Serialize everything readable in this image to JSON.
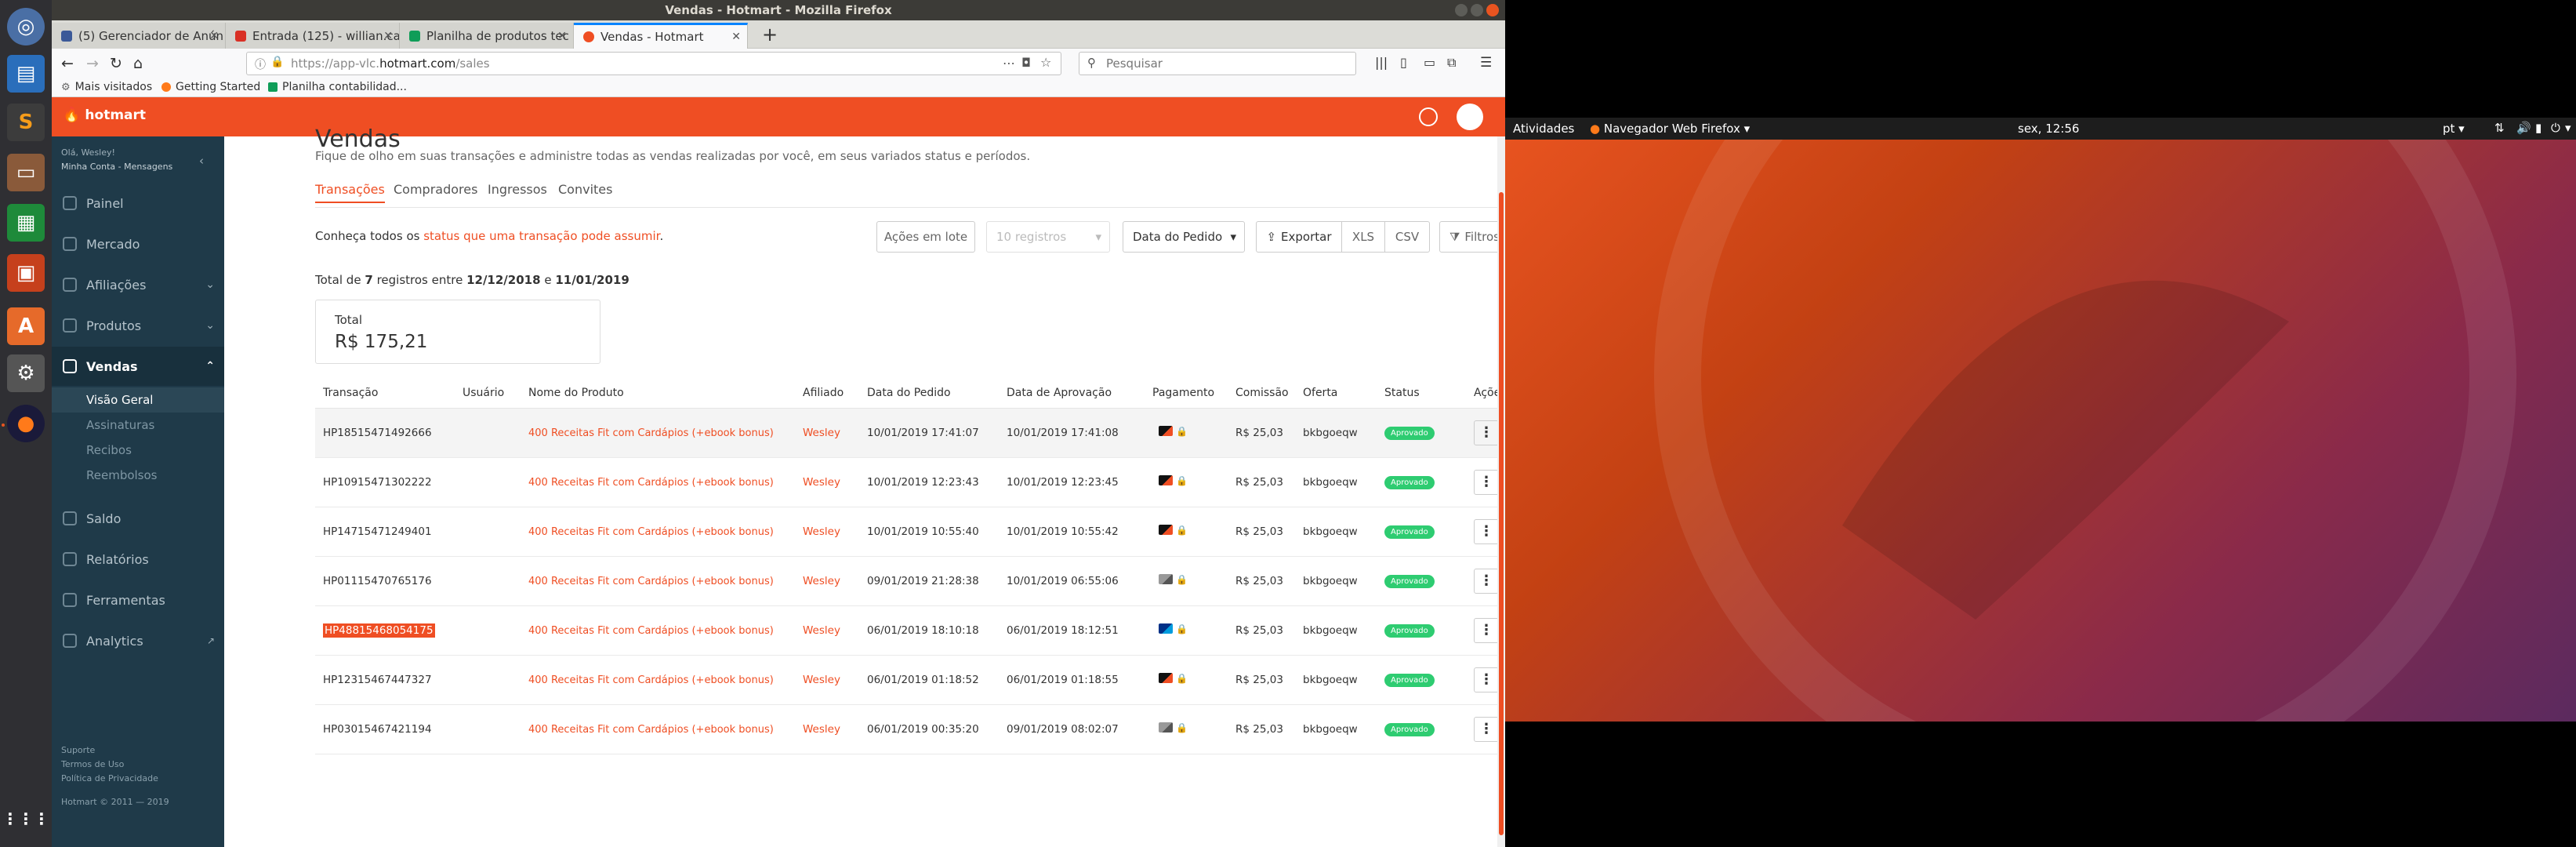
{
  "window": {
    "title": "Vendas - Hotmart - Mozilla Firefox"
  },
  "tabs": [
    {
      "label": "(5) Gerenciador de Anún",
      "color": "#3b5998"
    },
    {
      "label": "Entrada (125) - willian.ca",
      "color": "#d93025"
    },
    {
      "label": "Planilha de produtos tec",
      "color": "#0f9d58"
    },
    {
      "label": "Vendas - Hotmart",
      "color": "#ef4e23"
    }
  ],
  "url": {
    "prefix": "https://app-vlc.",
    "domain": "hotmart.com",
    "path": "/sales"
  },
  "search": {
    "placeholder": "Pesquisar"
  },
  "bookmarks": [
    "Mais visitados",
    "Getting Started",
    "Planilha contabilidad..."
  ],
  "brand": {
    "name": "hotmart",
    "accent": "#ef4e23",
    "sidebar_bg": "#1f3a49"
  },
  "sidebar": {
    "greeting": "Olá, Wesley!",
    "account_links": "Minha Conta - Mensagens",
    "items": [
      {
        "label": "Painel",
        "icon": "dashboard-icon"
      },
      {
        "label": "Mercado",
        "icon": "market-icon"
      },
      {
        "label": "Afiliações",
        "icon": "affiliations-icon"
      },
      {
        "label": "Produtos",
        "icon": "products-icon"
      },
      {
        "label": "Vendas",
        "icon": "sales-icon"
      },
      {
        "label": "Saldo",
        "icon": "balance-icon"
      },
      {
        "label": "Relatórios",
        "icon": "reports-icon"
      },
      {
        "label": "Ferramentas",
        "icon": "tools-icon"
      },
      {
        "label": "Analytics",
        "icon": "analytics-icon"
      }
    ],
    "vendas_sub": [
      "Visão Geral",
      "Assinaturas",
      "Recibos",
      "Reembolsos"
    ],
    "footer": {
      "support": "Suporte",
      "terms": "Termos de Uso",
      "privacy": "Política de Privacidade",
      "copyright": "Hotmart © 2011 — 2019"
    }
  },
  "page": {
    "title": "Vendas",
    "subtitle": "Fique de olho em suas transações e administre todas as vendas realizadas por você, em seus variados status e períodos.",
    "tabs": [
      "Transações",
      "Compradores",
      "Ingressos",
      "Convites"
    ],
    "know_prefix": "Conheça todos os",
    "know_link": "status que uma transação pode assumir",
    "know_suffix": ".",
    "toolbar": {
      "bulk": "Ações em lote",
      "per_page": "10 registros",
      "date_select": "Data do Pedido",
      "export": "Exportar",
      "xls": "XLS",
      "csv": "CSV",
      "filters": "Filtros"
    },
    "summary": {
      "prefix": "Total de",
      "count": "7",
      "middle": "registros entre",
      "start": "12/12/2018",
      "conj": "e",
      "end": "11/01/2019"
    },
    "total": {
      "label": "Total",
      "value": "R$ 175,21"
    }
  },
  "table": {
    "headers": [
      "Transação",
      "Usuário",
      "Nome do Produto",
      "Afiliado",
      "Data do Pedido",
      "Data de Aprovação",
      "Pagamento",
      "Comissão",
      "Oferta",
      "Status",
      "Ações"
    ],
    "rows": [
      {
        "tx": "HP18515471492666",
        "user": "",
        "product": "400 Receitas Fit com Cardápios (+ebook bonus)",
        "affiliate": "Wesley",
        "ordered": "10/01/2019 17:41:07",
        "approved": "10/01/2019 17:41:08",
        "payment": "card",
        "commission": "R$ 25,03",
        "offer": "bkbgoeqw",
        "status": "Aprovado"
      },
      {
        "tx": "HP10915471302222",
        "user": "",
        "product": "400 Receitas Fit com Cardápios (+ebook bonus)",
        "affiliate": "Wesley",
        "ordered": "10/01/2019 12:23:43",
        "approved": "10/01/2019 12:23:45",
        "payment": "card",
        "commission": "R$ 25,03",
        "offer": "bkbgoeqw",
        "status": "Aprovado"
      },
      {
        "tx": "HP14715471249401",
        "user": "",
        "product": "400 Receitas Fit com Cardápios (+ebook bonus)",
        "affiliate": "Wesley",
        "ordered": "10/01/2019 10:55:40",
        "approved": "10/01/2019 10:55:42",
        "payment": "card",
        "commission": "R$ 25,03",
        "offer": "bkbgoeqw",
        "status": "Aprovado"
      },
      {
        "tx": "HP01115470765176",
        "user": "",
        "product": "400 Receitas Fit com Cardápios (+ebook bonus)",
        "affiliate": "Wesley",
        "ordered": "09/01/2019 21:28:38",
        "approved": "10/01/2019 06:55:06",
        "payment": "boleto",
        "commission": "R$ 25,03",
        "offer": "bkbgoeqw",
        "status": "Aprovado"
      },
      {
        "tx": "HP48815468054175",
        "user": "",
        "product": "400 Receitas Fit com Cardápios (+ebook bonus)",
        "affiliate": "Wesley",
        "ordered": "06/01/2019 18:10:18",
        "approved": "06/01/2019 18:12:51",
        "payment": "paypal",
        "commission": "R$ 25,03",
        "offer": "bkbgoeqw",
        "status": "Aprovado"
      },
      {
        "tx": "HP12315467447327",
        "user": "",
        "product": "400 Receitas Fit com Cardápios (+ebook bonus)",
        "affiliate": "Wesley",
        "ordered": "06/01/2019 01:18:52",
        "approved": "06/01/2019 01:18:55",
        "payment": "card",
        "commission": "R$ 25,03",
        "offer": "bkbgoeqw",
        "status": "Aprovado"
      },
      {
        "tx": "HP03015467421194",
        "user": "",
        "product": "400 Receitas Fit com Cardápios (+ebook bonus)",
        "affiliate": "Wesley",
        "ordered": "06/01/2019 00:35:20",
        "approved": "09/01/2019 08:02:07",
        "payment": "boleto",
        "commission": "R$ 25,03",
        "offer": "bkbgoeqw",
        "status": "Aprovado"
      }
    ]
  },
  "monitor2": {
    "activities": "Atividades",
    "app": "Navegador Web Firefox",
    "clock": "sex, 12:56",
    "lang": "pt"
  }
}
